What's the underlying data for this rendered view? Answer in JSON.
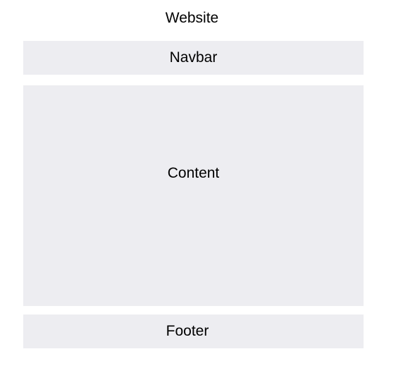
{
  "diagram": {
    "title": "Website",
    "sections": {
      "navbar": "Navbar",
      "content": "Content",
      "footer": "Footer"
    }
  }
}
